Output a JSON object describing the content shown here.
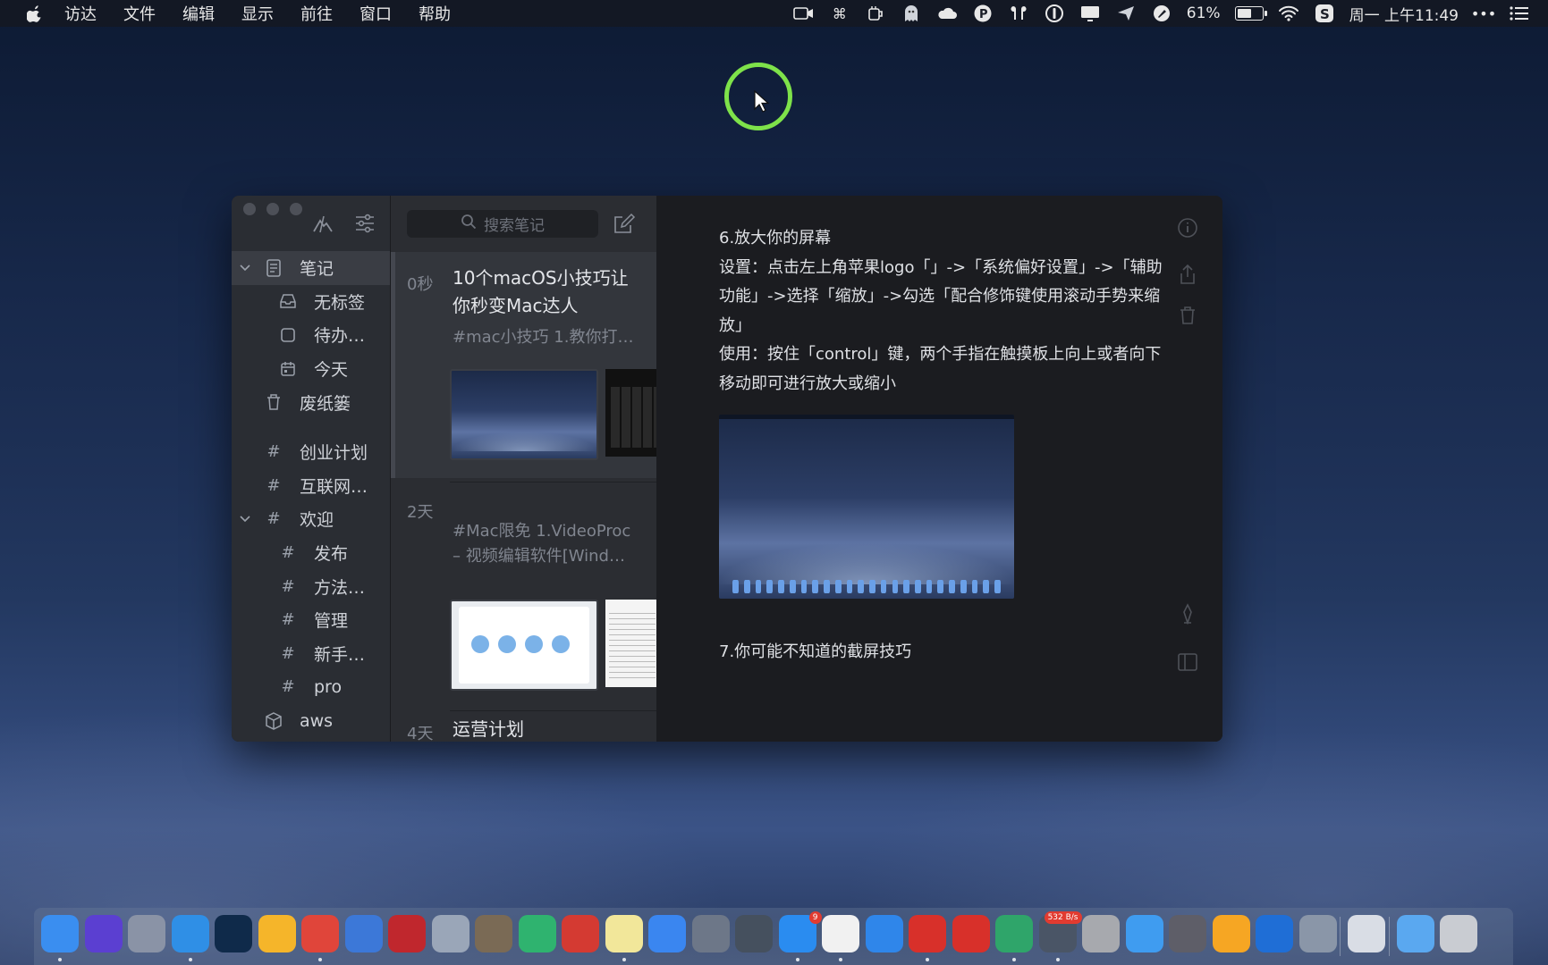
{
  "menubar": {
    "app_menus": [
      "访达",
      "文件",
      "编辑",
      "显示",
      "前往",
      "窗口",
      "帮助"
    ],
    "battery_percent_text": "61%",
    "battery_level": 0.61,
    "clock": "周一 上午11:49",
    "status_icons": [
      "video-camera-icon",
      "command-icon",
      "cup-icon",
      "ghost-icon",
      "cloud-icon",
      "p-circle-icon",
      "airpods-icon",
      "one-password-icon",
      "notification-monitor-icon",
      "paper-plane-icon",
      "drawing-app-icon",
      "battery-icon",
      "wifi-icon",
      "s-app-icon",
      "more-icon",
      "list-icon"
    ]
  },
  "sidebar": {
    "items": [
      {
        "label": "笔记",
        "icon": "notes-icon",
        "expanded": true,
        "active": true
      },
      {
        "label": "无标签",
        "icon": "inbox-icon"
      },
      {
        "label": "待办…",
        "icon": "checkbox-icon"
      },
      {
        "label": "今天",
        "icon": "calendar-icon"
      },
      {
        "label": "废纸篓",
        "icon": "trash-icon"
      },
      {
        "label": "创业计划",
        "icon": "hash-icon"
      },
      {
        "label": "互联网…",
        "icon": "hash-icon"
      },
      {
        "label": "欢迎",
        "icon": "hash-icon",
        "expanded": true
      },
      {
        "label": "发布",
        "icon": "hash-icon"
      },
      {
        "label": "方法…",
        "icon": "hash-icon"
      },
      {
        "label": "管理",
        "icon": "hash-icon"
      },
      {
        "label": "新手…",
        "icon": "hash-icon"
      },
      {
        "label": "pro",
        "icon": "hash-icon"
      },
      {
        "label": "aws",
        "icon": "box-icon"
      }
    ]
  },
  "notes_list": {
    "search_placeholder": "搜索笔记",
    "notes": [
      {
        "age": "0秒",
        "title": "10个macOS小技巧让你秒变Mac达人",
        "excerpt": "#mac小技巧 1.教你打…"
      },
      {
        "age": "2天",
        "title": "",
        "excerpt": "#Mac限免 1.VideoProc – 视频编辑软件[Wind…"
      },
      {
        "age": "4天",
        "title": "运营计划",
        "excerpt": ""
      }
    ]
  },
  "editor": {
    "paragraphs": [
      "6.放大你的屏幕",
      "设置：点击左上角苹果logo「」->「系统偏好设置」->「辅助功能」->选择「缩放」->勾选「配合修饰键使用滚动手势来缩放」",
      "使用：按住「control」键，两个手指在触摸板上向上或者向下移动即可进行放大或缩小"
    ],
    "heading2": "7.你可能不知道的截屏技巧"
  },
  "dock": {
    "apps": [
      {
        "name": "finder",
        "color": "#3a8ef0"
      },
      {
        "name": "siri",
        "color": "#5b3fd1"
      },
      {
        "name": "launchpad",
        "color": "#8a93a6"
      },
      {
        "name": "safari",
        "color": "#2f8fe6"
      },
      {
        "name": "photoshop",
        "color": "#0f2a4a"
      },
      {
        "name": "sketch",
        "color": "#f5b52a"
      },
      {
        "name": "chrome",
        "color": "#e0453a"
      },
      {
        "name": "chrome-canary",
        "color": "#3c78d8"
      },
      {
        "name": "filezilla",
        "color": "#c0272d"
      },
      {
        "name": "preview",
        "color": "#9aa6b8"
      },
      {
        "name": "package",
        "color": "#7a6a55"
      },
      {
        "name": "infuse",
        "color": "#2fb36f"
      },
      {
        "name": "bird-app",
        "color": "#d43a32"
      },
      {
        "name": "notes",
        "color": "#f2e79a"
      },
      {
        "name": "baidu-netdisk",
        "color": "#3a86f0"
      },
      {
        "name": "system-prefs",
        "color": "#6d7788"
      },
      {
        "name": "scanner",
        "color": "#45505e"
      },
      {
        "name": "app-store",
        "color": "#2a8cf0"
      },
      {
        "name": "qq",
        "color": "#f1f1f1"
      },
      {
        "name": "icloud",
        "color": "#2f86ea"
      },
      {
        "name": "mail-cn",
        "color": "#d8302a"
      },
      {
        "name": "netease-music",
        "color": "#d8302a"
      },
      {
        "name": "atom",
        "color": "#2fa56a"
      },
      {
        "name": "istat-menus",
        "color": "#4a5566"
      },
      {
        "name": "archive-utility",
        "color": "#a7a9ae"
      },
      {
        "name": "messages",
        "color": "#3f9cf0"
      },
      {
        "name": "photo-booth",
        "color": "#5e5e68"
      },
      {
        "name": "bear-app",
        "color": "#f6a623"
      },
      {
        "name": "quicktime",
        "color": "#1f6ed6"
      },
      {
        "name": "keyboard-app",
        "color": "#8a96a8"
      },
      {
        "name": "rar",
        "color": "#d9dde5"
      },
      {
        "name": "folder",
        "color": "#5aa8f0"
      },
      {
        "name": "trash",
        "color": "#c9ccd2"
      }
    ],
    "badges": [
      {
        "app": "app-store",
        "text": "9"
      },
      {
        "app": "istat-menus",
        "text": "532 B/s"
      }
    ]
  }
}
